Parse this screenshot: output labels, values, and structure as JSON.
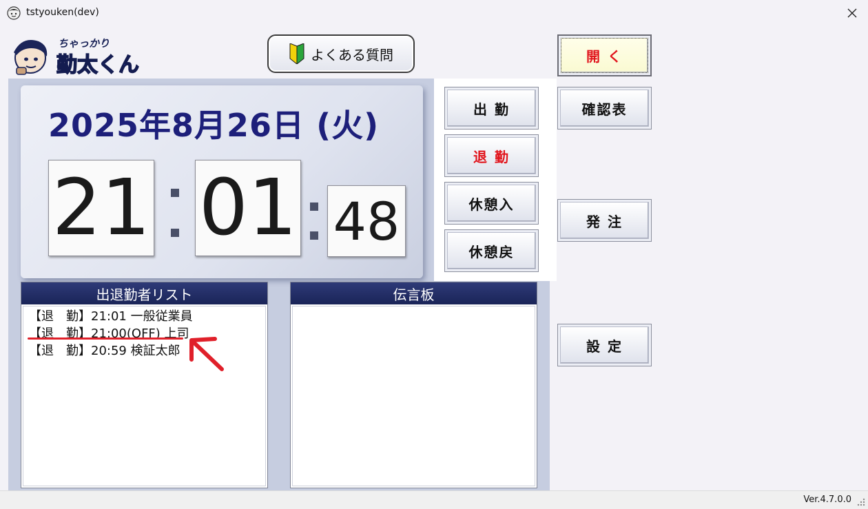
{
  "window": {
    "title": "tstyouken(dev)"
  },
  "header": {
    "faq_label": "よくある質問"
  },
  "clock": {
    "date": "2025年8月26日 (火)",
    "hours": "21",
    "minutes": "01",
    "seconds": "48"
  },
  "punch_buttons": {
    "clock_in": "出 勤",
    "clock_out": "退 勤",
    "break_start": "休憩入",
    "break_end": "休憩戻"
  },
  "side_buttons": {
    "open": "開 く",
    "confirm_sheet": "確認表",
    "order": "発 注",
    "settings": "設 定"
  },
  "attendance_list": {
    "title": "出退勤者リスト",
    "items": [
      "【退　勤】21:01 一般従業員",
      "【退　勤】21:00(OFF) 上司",
      "【退　勤】20:59 検証太郎"
    ]
  },
  "message_board": {
    "title": "伝言板"
  },
  "status_bar": {
    "version": "Ver.4.7.0.0"
  },
  "colors": {
    "header_navy": "#1d1f7a",
    "accent_red": "#e1141c",
    "panel_blue": "#c6cde0"
  }
}
